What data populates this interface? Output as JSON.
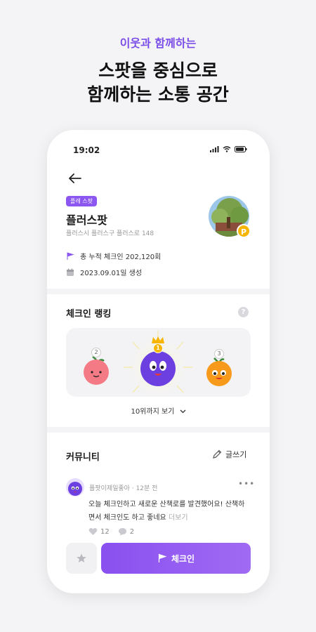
{
  "promo": {
    "subtitle": "이웃과 함께하는",
    "title_line1": "스팟을 중심으로",
    "title_line2": "함께하는 소통 공간"
  },
  "status": {
    "time": "19:02"
  },
  "spot": {
    "badge": "플레 스팟",
    "name": "플러스팟",
    "address": "플러스시 플러스구 플러스로 148",
    "avatar_badge": "P",
    "checkin_total": "총 누적 체크인 202,120회",
    "created": "2023.09.01일 생성"
  },
  "ranking": {
    "title": "체크인 랭킹",
    "help": "?",
    "ranks": [
      "2",
      "1",
      "3"
    ],
    "more": "10위까지 보기"
  },
  "community": {
    "title": "커뮤니티",
    "write": "글쓰기",
    "post": {
      "author": "플팟이제일좋아",
      "time": "12분 전",
      "body": "오늘 체크인하고 새로운 산책로를 발견했어요! 산책하면서 체크인도 하고 좋네요",
      "more": "더보기",
      "likes": "12",
      "comments": "2"
    }
  },
  "actions": {
    "checkin": "체크인"
  },
  "colors": {
    "accent": "#8b57f0",
    "gold": "#f7b500"
  }
}
